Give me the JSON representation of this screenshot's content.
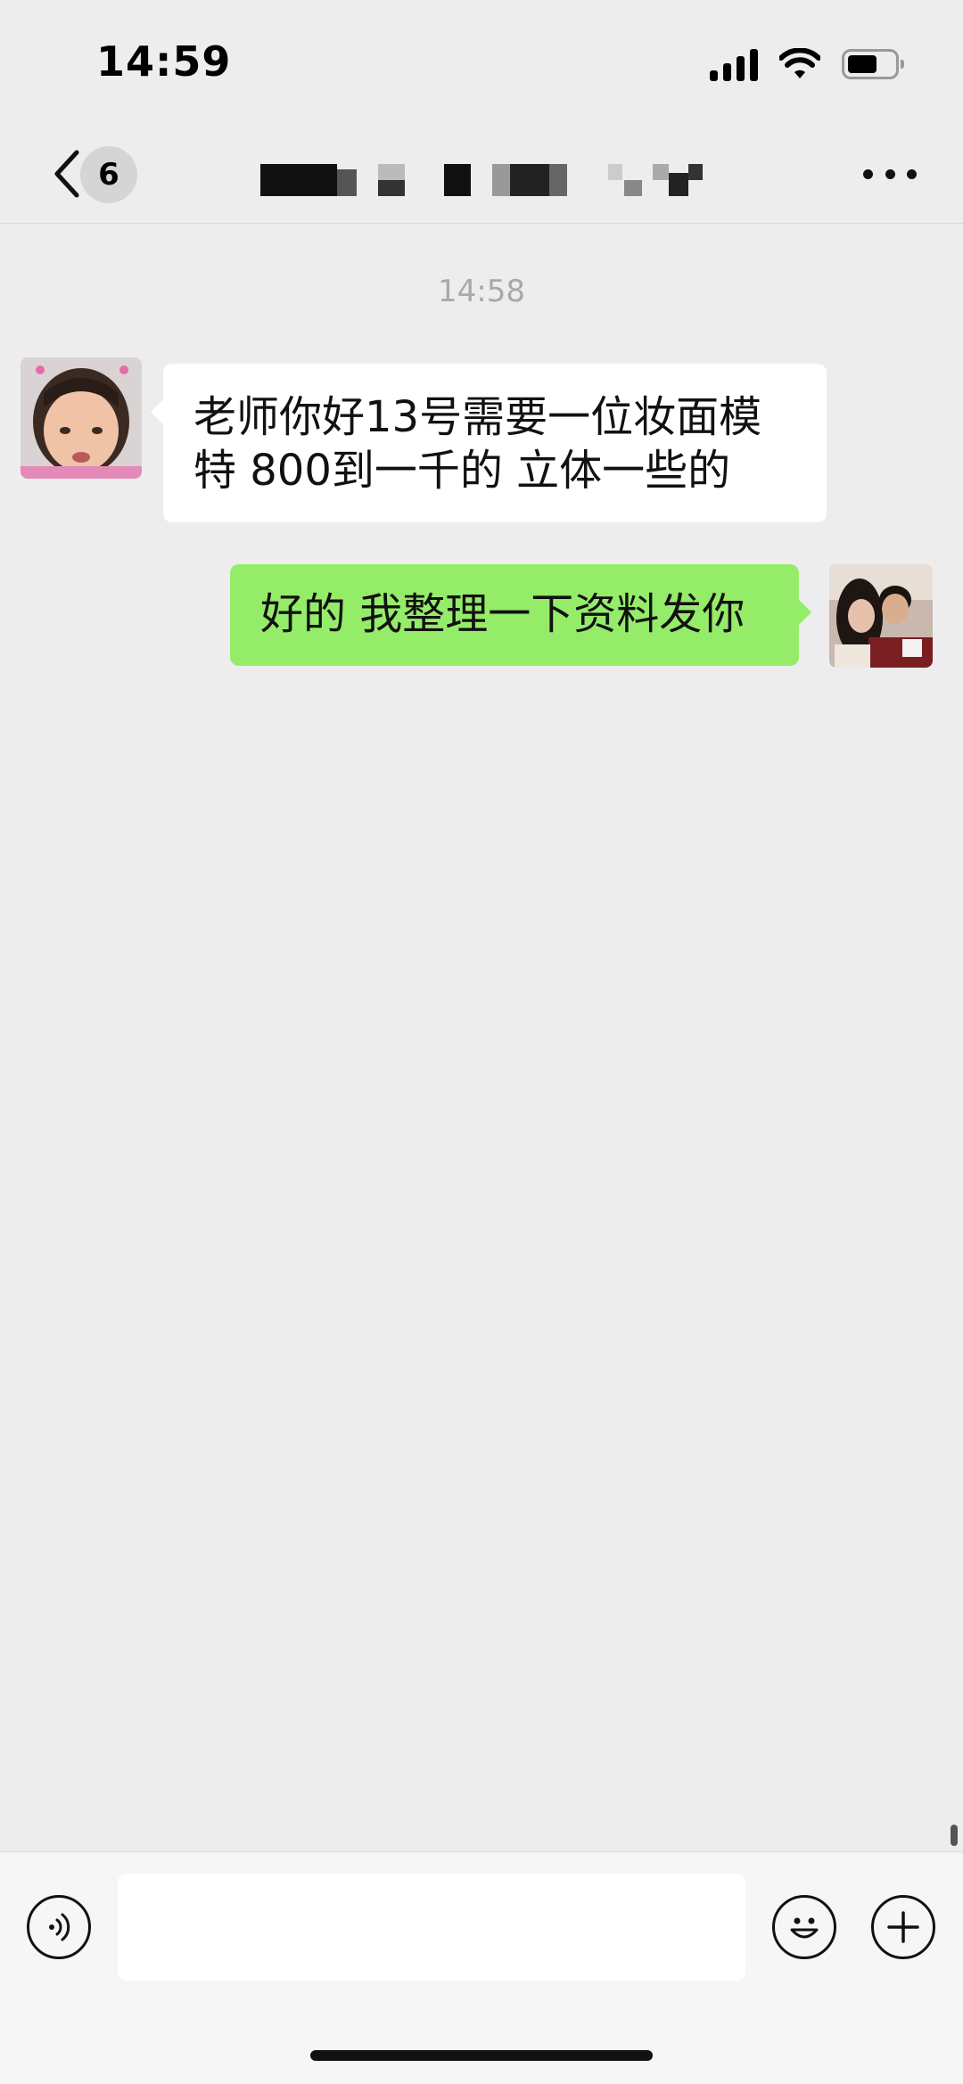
{
  "status_bar": {
    "time": "14:59",
    "icons": [
      "signal-icon",
      "wifi-icon",
      "battery-icon"
    ],
    "battery_level": 0.6
  },
  "nav": {
    "back_icon": "chevron-left-icon",
    "unread_count": "6",
    "title_redacted": true,
    "more_icon": "more-dots-icon"
  },
  "chat": {
    "timestamp": "14:58",
    "messages": [
      {
        "side": "left",
        "lines": [
          "老师你好13号需要一位妆面模",
          "特 800到一千的 立体一些的"
        ]
      },
      {
        "side": "right",
        "lines": [
          "好的 我整理一下资料发你"
        ]
      }
    ]
  },
  "input_bar": {
    "voice_icon": "voice-icon",
    "emoji_icon": "emoji-icon",
    "add_icon": "plus-icon",
    "input_value": ""
  },
  "colors": {
    "background": "#ededed",
    "sent_bubble": "#95ec69",
    "received_bubble": "#ffffff"
  }
}
